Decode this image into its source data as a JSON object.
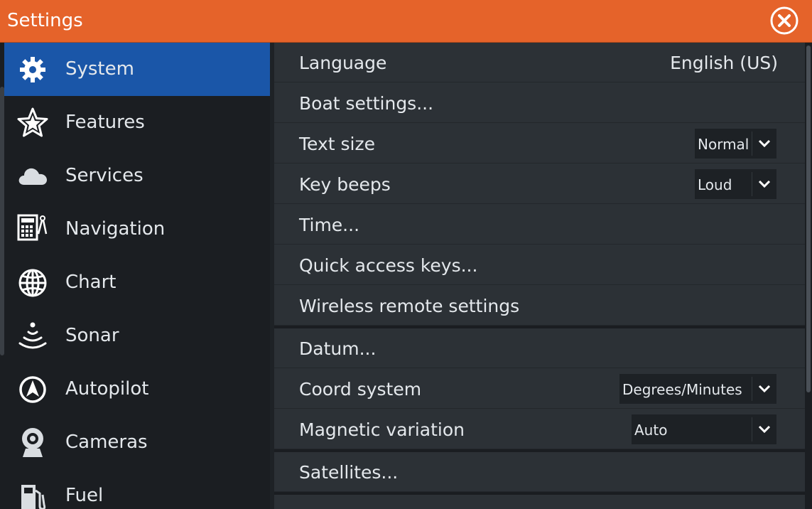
{
  "window": {
    "title": "Settings",
    "close_icon": "close-circle-icon"
  },
  "sidebar": {
    "items": [
      {
        "label": "System",
        "icon": "gear-icon",
        "active": true
      },
      {
        "label": "Features",
        "icon": "star-icon"
      },
      {
        "label": "Services",
        "icon": "cloud-icon"
      },
      {
        "label": "Navigation",
        "icon": "calculator-compass-icon"
      },
      {
        "label": "Chart",
        "icon": "globe-icon"
      },
      {
        "label": "Sonar",
        "icon": "sonar-icon"
      },
      {
        "label": "Autopilot",
        "icon": "autopilot-icon"
      },
      {
        "label": "Cameras",
        "icon": "camera-icon"
      },
      {
        "label": "Fuel",
        "icon": "fuel-pump-icon"
      }
    ]
  },
  "settings": {
    "language": {
      "label": "Language",
      "value": "English (US)"
    },
    "boat_settings": {
      "label": "Boat settings..."
    },
    "text_size": {
      "label": "Text size",
      "value": "Normal"
    },
    "key_beeps": {
      "label": "Key beeps",
      "value": "Loud"
    },
    "time": {
      "label": "Time..."
    },
    "quick_access_keys": {
      "label": "Quick access keys..."
    },
    "wireless_remote": {
      "label": "Wireless remote settings"
    },
    "datum": {
      "label": "Datum..."
    },
    "coord_system": {
      "label": "Coord system",
      "value": "Degrees/Minutes"
    },
    "magnetic_variation": {
      "label": "Magnetic variation",
      "value": "Auto"
    },
    "satellites": {
      "label": "Satellites..."
    }
  },
  "colors": {
    "titlebar": "#e5632a",
    "active_item": "#1a56a8",
    "panel": "#2c3136",
    "sidebar": "#1b1e22"
  }
}
